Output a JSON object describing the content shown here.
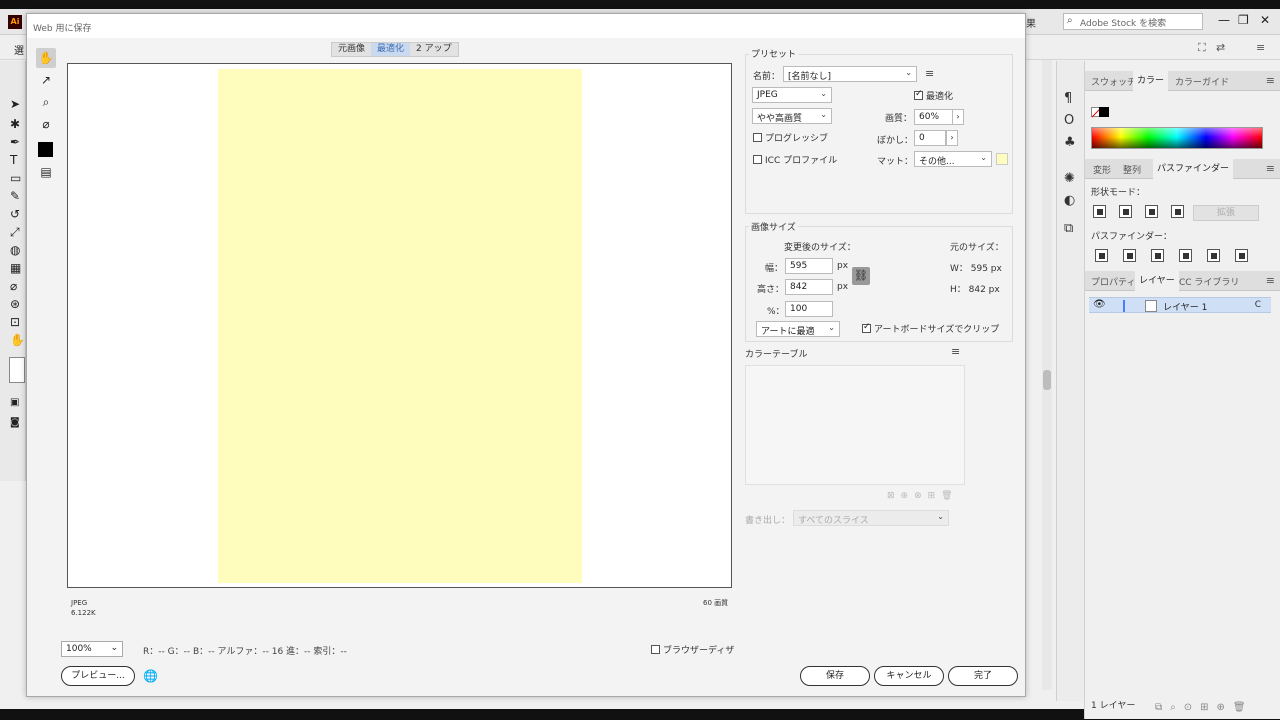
{
  "app": {
    "logo": "Ai",
    "menu_stub": "果",
    "stock_search_placeholder": "Adobe Stock を検索",
    "selection_label": "選",
    "win_controls": [
      "—",
      "❐",
      "✕"
    ],
    "panels": {
      "color_tabs": [
        "スウォッチ",
        "カラー",
        "カラーガイド"
      ],
      "pathfinder_tabs": [
        "変形",
        "整列",
        "パスファインダー"
      ],
      "shape_mode_label": "形状モード：",
      "pathfinder_label": "パスファインダー：",
      "expand_label": "拡張",
      "layers_tabs": [
        "プロパティ",
        "レイヤー",
        "CC ライブラリ"
      ],
      "layer_name": "レイヤー 1",
      "layer_count": "1 レイヤー",
      "target_marker": "C"
    }
  },
  "dialog": {
    "title": "Web 用に保存",
    "view_tabs": [
      "元画像",
      "最適化",
      "2 アップ"
    ],
    "active_view_tab": 1,
    "preview_format": "JPEG",
    "preview_size": "6.122K",
    "preview_quality": "60 画質",
    "zoom": "100%",
    "pixel_info": "R：-- G：-- B：-- アルファ：-- 16 進：-- 索引：--",
    "browser_dither_label": "ブラウザーディザ",
    "preview_button": "プレビュー...",
    "save_button": "保存",
    "cancel_button": "キャンセル",
    "done_button": "完了",
    "preset": {
      "title": "プリセット",
      "name_label": "名前：",
      "name_value": "[名前なし]",
      "format": "JPEG",
      "optimize_label": "最適化",
      "optimize_checked": true,
      "quality_preset": "やや高画質",
      "quality_label": "画質：",
      "quality_value": "60%",
      "progressive_label": "プログレッシブ",
      "progressive_checked": false,
      "blur_label": "ぼかし：",
      "blur_value": "0",
      "icc_label": "ICC プロファイル",
      "icc_checked": false,
      "matte_label": "マット：",
      "matte_value": "その他..."
    },
    "image_size": {
      "title": "画像サイズ",
      "new_size_label": "変更後のサイズ：",
      "original_size_label": "元のサイズ：",
      "width_label": "幅：",
      "width_value": "595",
      "height_label": "高さ：",
      "height_value": "842",
      "percent_label": "%：",
      "percent_value": "100",
      "unit": "px",
      "orig_w": "W： 595 px",
      "orig_h": "H： 842 px",
      "resample": "アートに最適",
      "clip_label": "アートボードサイズでクリップ",
      "clip_checked": true
    },
    "color_table_title": "カラーテーブル",
    "export_label": "書き出し：",
    "export_value": "すべてのスライス"
  }
}
